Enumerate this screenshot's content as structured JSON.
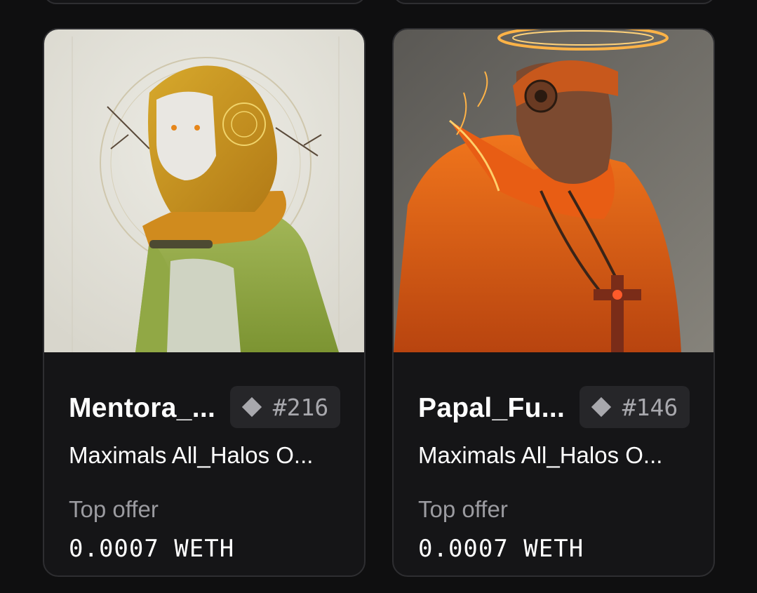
{
  "cards": [
    {
      "name": "Mentora_...",
      "token_id": "#216",
      "collection": "Maximals All_Halos O...",
      "offer_label": "Top offer",
      "offer_value": "0.0007 WETH",
      "image": "green-hooded-figure-art"
    },
    {
      "name": "Papal_Fu...",
      "token_id": "#146",
      "collection": "Maximals All_Halos O...",
      "offer_label": "Top offer",
      "offer_value": "0.0007 WETH",
      "image": "orange-robed-pope-cyborg-art"
    }
  ],
  "icons": {
    "token": "ethereum-diamond-icon"
  },
  "colors": {
    "background": "#0f0f10",
    "card_bg": "#151517",
    "card_border": "#2e2e31",
    "chip_bg": "#262629",
    "muted_text": "#9b9ba0"
  }
}
